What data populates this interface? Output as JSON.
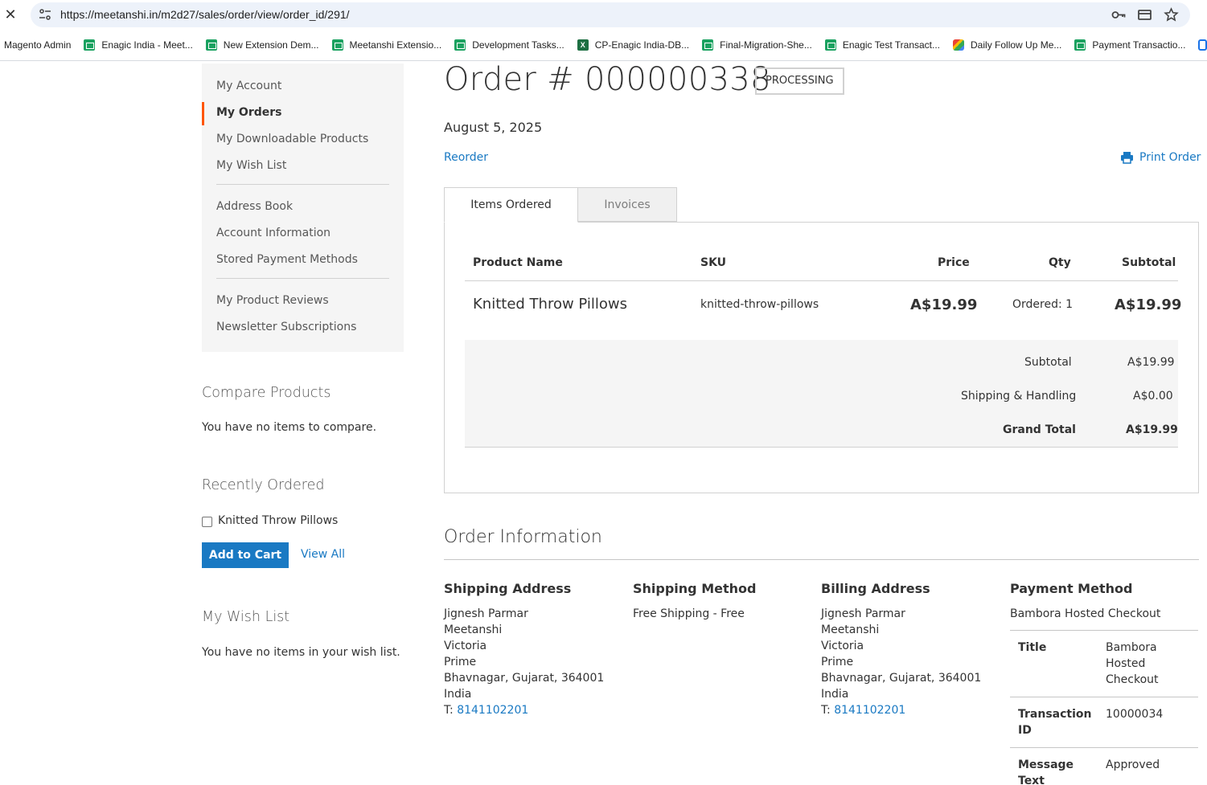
{
  "browser": {
    "url": "https://meetanshi.in/m2d27/sales/order/view/order_id/291/",
    "bookmarks": [
      {
        "label": "Magento Admin",
        "icon": "none"
      },
      {
        "label": "Enagic India - Meet...",
        "icon": "sheets-icon"
      },
      {
        "label": "New Extension Dem...",
        "icon": "sheets-icon"
      },
      {
        "label": "Meetanshi Extensio...",
        "icon": "sheets-icon"
      },
      {
        "label": "Development Tasks...",
        "icon": "sheets-icon"
      },
      {
        "label": "CP-Enagic India-DB...",
        "icon": "excel-icon"
      },
      {
        "label": "Final-Migration-She...",
        "icon": "sheets-icon"
      },
      {
        "label": "Enagic Test Transact...",
        "icon": "sheets-icon"
      },
      {
        "label": "Daily Follow Up Me...",
        "icon": "meet-icon"
      },
      {
        "label": "Payment Transactio...",
        "icon": "sheets-icon"
      }
    ]
  },
  "sidebar": {
    "nav": [
      {
        "label": "My Account"
      },
      {
        "label": "My Orders"
      },
      {
        "label": "My Downloadable Products"
      },
      {
        "label": "My Wish List"
      },
      {
        "label": "Address Book"
      },
      {
        "label": "Account Information"
      },
      {
        "label": "Stored Payment Methods"
      },
      {
        "label": "My Product Reviews"
      },
      {
        "label": "Newsletter Subscriptions"
      }
    ],
    "compare": {
      "title": "Compare Products",
      "text": "You have no items to compare."
    },
    "recent": {
      "title": "Recently Ordered",
      "item": "Knitted Throw Pillows",
      "add_to_cart": "Add to Cart",
      "view_all": "View All"
    },
    "wishlist": {
      "title": "My Wish List",
      "text": "You have no items in your wish list."
    }
  },
  "order": {
    "title": "Order # 000000338",
    "status": "PROCESSING",
    "date": "August 5, 2025",
    "reorder": "Reorder",
    "print": "Print Order",
    "tabs": [
      {
        "label": "Items Ordered"
      },
      {
        "label": "Invoices"
      }
    ],
    "headers": {
      "product": "Product Name",
      "sku": "SKU",
      "price": "Price",
      "qty": "Qty",
      "subtotal": "Subtotal"
    },
    "items": [
      {
        "name": "Knitted Throw Pillows",
        "sku": "knitted-throw-pillows",
        "price": "A$19.99",
        "qty": "Ordered: 1",
        "subtotal": "A$19.99"
      }
    ],
    "totals": {
      "subtotal_label": "Subtotal",
      "subtotal": "A$19.99",
      "shipping_label": "Shipping & Handling",
      "shipping": "A$0.00",
      "grand_label": "Grand Total",
      "grand": "A$19.99"
    }
  },
  "info": {
    "title": "Order Information",
    "shipping_address": {
      "title": "Shipping Address",
      "name": "Jignesh Parmar",
      "company": "Meetanshi",
      "street1": "Victoria",
      "street2": "Prime",
      "city": "Bhavnagar, Gujarat, 364001",
      "country": "India",
      "phone_prefix": "T: ",
      "phone": "8141102201"
    },
    "shipping_method": {
      "title": "Shipping Method",
      "value": "Free Shipping - Free"
    },
    "billing_address": {
      "title": "Billing Address",
      "name": "Jignesh Parmar",
      "company": "Meetanshi",
      "street1": "Victoria",
      "street2": "Prime",
      "city": "Bhavnagar, Gujarat, 364001",
      "country": "India",
      "phone_prefix": "T: ",
      "phone": "8141102201"
    },
    "payment_method": {
      "title": "Payment Method",
      "name": "Bambora Hosted Checkout",
      "rows": [
        {
          "key": "Title",
          "value": "Bambora Hosted Checkout"
        },
        {
          "key": "Transaction ID",
          "value": "10000034"
        },
        {
          "key": "Message Text",
          "value": "Approved"
        }
      ]
    }
  },
  "colors": {
    "link": "#1979c3",
    "accent": "#ff5501",
    "button": "#1979c3"
  }
}
